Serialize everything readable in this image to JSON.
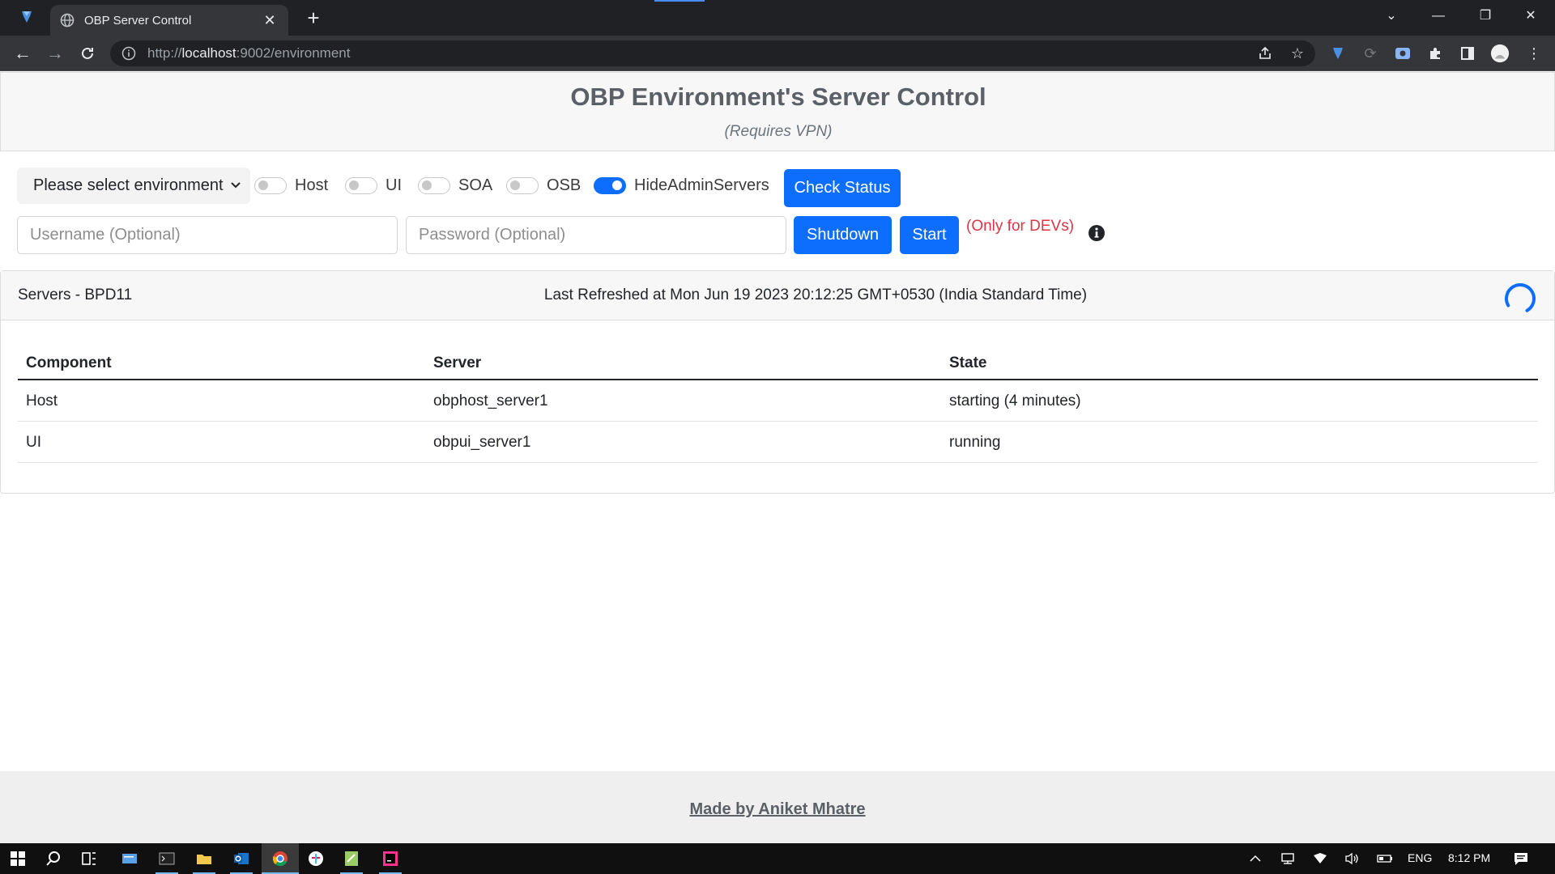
{
  "browser": {
    "tab_title": "OBP Server Control",
    "tab_close": "✕",
    "new_tab": "+",
    "url_scheme": "http://",
    "url_host": "localhost",
    "url_path": ":9002/environment",
    "controls": {
      "minimize": "—",
      "restore": "❐",
      "close": "✕",
      "tab_search": "⌄"
    }
  },
  "header": {
    "title": "OBP Environment's Server Control",
    "subtitle": "(Requires VPN)"
  },
  "controls": {
    "environment_select": "Please select environment",
    "toggles": [
      {
        "label": "Host",
        "on": false
      },
      {
        "label": "UI",
        "on": false
      },
      {
        "label": "SOA",
        "on": false
      },
      {
        "label": "OSB",
        "on": false
      },
      {
        "label": "HideAdminServers",
        "on": true
      }
    ],
    "check_status_label": "Check Status",
    "username_placeholder": "Username (Optional)",
    "password_placeholder": "Password (Optional)",
    "shutdown_label": "Shutdown",
    "start_label": "Start",
    "dev_note": "(Only for DEVs)"
  },
  "servers": {
    "title": "Servers - BPD11",
    "last_refreshed": "Last Refreshed at Mon Jun 19 2023 20:12:25 GMT+0530 (India Standard Time)",
    "columns": [
      "Component",
      "Server",
      "State"
    ],
    "rows": [
      [
        "Host",
        "obphost_server1",
        "starting (4 minutes)"
      ],
      [
        "UI",
        "obpui_server1",
        "running"
      ]
    ]
  },
  "footer": {
    "credit": "Made by Aniket Mhatre"
  },
  "taskbar": {
    "language": "ENG",
    "time": "8:12 PM"
  },
  "colors": {
    "primary": "#0d6efd",
    "danger": "#dc3545",
    "title_gray": "#5b6066"
  }
}
